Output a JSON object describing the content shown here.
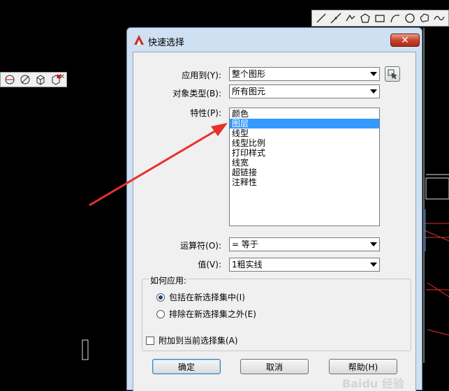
{
  "dialog": {
    "title": "快速选择",
    "close_label": "✕",
    "apply_to": {
      "label": "应用到(Y):",
      "value": "整个图形"
    },
    "object_type": {
      "label": "对象类型(B):",
      "value": "所有图元"
    },
    "properties": {
      "label": "特性(P):",
      "items": [
        "颜色",
        "图层",
        "线型",
        "线型比例",
        "打印样式",
        "线宽",
        "超链接",
        "注释性"
      ],
      "selected": "图层"
    },
    "operator": {
      "label": "运算符(O):",
      "value": "= 等于"
    },
    "value": {
      "label": "值(V):",
      "value": "1粗实线"
    },
    "how_to_apply": {
      "title": "如何应用:",
      "include": "包括在新选择集中(I)",
      "exclude": "排除在新选择集之外(E)",
      "selected": "include"
    },
    "append": {
      "label": "附加到当前选择集(A)",
      "checked": false
    },
    "buttons": {
      "ok": "确定",
      "cancel": "取消",
      "help": "帮助(H)"
    }
  },
  "watermark": "Baidu 经验",
  "colors": {
    "title_bar": "#cfe0f3",
    "selection": "#3399ff",
    "annotation_arrow": "#e8312a",
    "close_button": "#c9452b"
  }
}
